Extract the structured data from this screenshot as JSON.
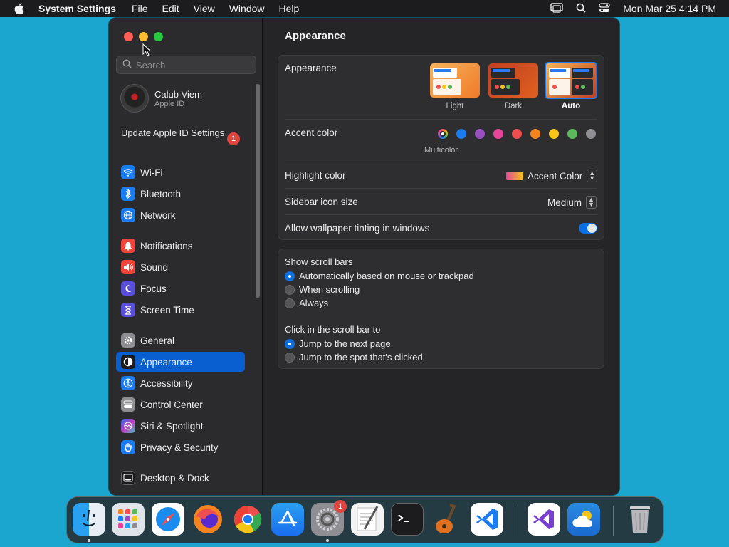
{
  "menubar": {
    "app_name": "System Settings",
    "items": [
      "File",
      "Edit",
      "View",
      "Window",
      "Help"
    ],
    "clock": "Mon Mar 25  4:14 PM"
  },
  "sidebar": {
    "search_placeholder": "Search",
    "profile": {
      "name": "Calub Viem",
      "subtitle": "Apple ID"
    },
    "update": {
      "label": "Update Apple ID Settings",
      "badge": "1"
    },
    "items": [
      {
        "label": "Wi-Fi",
        "icon": "wifi-icon",
        "color": "#1a7cf0"
      },
      {
        "label": "Bluetooth",
        "icon": "bluetooth-icon",
        "color": "#1a7cf0"
      },
      {
        "label": "Network",
        "icon": "globe-icon",
        "color": "#1a7cf0"
      },
      {
        "label": "Notifications",
        "icon": "bell-icon",
        "color": "#f0453a"
      },
      {
        "label": "Sound",
        "icon": "speaker-icon",
        "color": "#f0453a"
      },
      {
        "label": "Focus",
        "icon": "moon-icon",
        "color": "#5a4fd8"
      },
      {
        "label": "Screen Time",
        "icon": "hourglass-icon",
        "color": "#5a4fd8"
      },
      {
        "label": "General",
        "icon": "gear-icon",
        "color": "#8e8e93"
      },
      {
        "label": "Appearance",
        "icon": "appearance-icon",
        "color": "#1c1c1e"
      },
      {
        "label": "Accessibility",
        "icon": "accessibility-icon",
        "color": "#1a7cf0"
      },
      {
        "label": "Control Center",
        "icon": "control-center-icon",
        "color": "#8e8e93"
      },
      {
        "label": "Siri & Spotlight",
        "icon": "siri-icon",
        "color": "#6a3fd0"
      },
      {
        "label": "Privacy & Security",
        "icon": "hand-icon",
        "color": "#1a7cf0"
      },
      {
        "label": "Desktop & Dock",
        "icon": "dock-icon",
        "color": "#1c1c1e"
      }
    ],
    "active_item": "Appearance"
  },
  "main": {
    "title": "Appearance",
    "appearance": {
      "label": "Appearance",
      "options": [
        "Light",
        "Dark",
        "Auto"
      ],
      "selected": "Auto"
    },
    "accent": {
      "label": "Accent color",
      "selected_name": "Multicolor",
      "colors": [
        "#1a7cf0",
        "#9a4fc0",
        "#e5469a",
        "#ef4e4e",
        "#f5841f",
        "#f5c518",
        "#5cb85c",
        "#8e8e93"
      ]
    },
    "highlight": {
      "label": "Highlight color",
      "value": "Accent Color"
    },
    "sidebar_icon_size": {
      "label": "Sidebar icon size",
      "value": "Medium"
    },
    "wallpaper_tinting": {
      "label": "Allow wallpaper tinting in windows",
      "enabled": true
    },
    "scroll_bars": {
      "label": "Show scroll bars",
      "options": [
        "Automatically based on mouse or trackpad",
        "When scrolling",
        "Always"
      ],
      "selected": 0
    },
    "click_scroll": {
      "label": "Click in the scroll bar to",
      "options": [
        "Jump to the next page",
        "Jump to the spot that's clicked"
      ],
      "selected": 0
    },
    "help": "?"
  },
  "dock": {
    "apps": [
      "Finder",
      "Launchpad",
      "Safari",
      "Firefox",
      "Chrome",
      "App Store",
      "System Settings",
      "TextEdit",
      "Terminal",
      "GarageBand",
      "Visual Studio Code",
      "Visual Studio",
      "Weather",
      "Trash"
    ],
    "settings_badge": "1"
  }
}
